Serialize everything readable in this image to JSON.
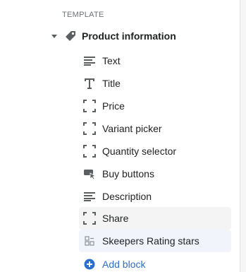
{
  "section_header": "TEMPLATE",
  "section": {
    "title": "Product information",
    "expanded": true
  },
  "blocks": [
    {
      "label": "Text",
      "icon": "text-lines-icon"
    },
    {
      "label": "Title",
      "icon": "title-t-icon"
    },
    {
      "label": "Price",
      "icon": "dashed-frame-icon"
    },
    {
      "label": "Variant picker",
      "icon": "dashed-frame-icon"
    },
    {
      "label": "Quantity selector",
      "icon": "dashed-frame-icon"
    },
    {
      "label": "Buy buttons",
      "icon": "button-cursor-icon"
    },
    {
      "label": "Description",
      "icon": "text-lines-icon"
    },
    {
      "label": "Share",
      "icon": "dashed-frame-icon"
    },
    {
      "label": "Skeepers Rating stars",
      "icon": "app-block-icon"
    }
  ],
  "add_block": {
    "label": "Add block",
    "icon": "plus-circle-icon"
  },
  "colors": {
    "text": "#202223",
    "muted": "#6d7175",
    "link": "#2c6ecb",
    "hover_bg": "#f4f4f5",
    "selected_bg": "#f1f5fb"
  }
}
